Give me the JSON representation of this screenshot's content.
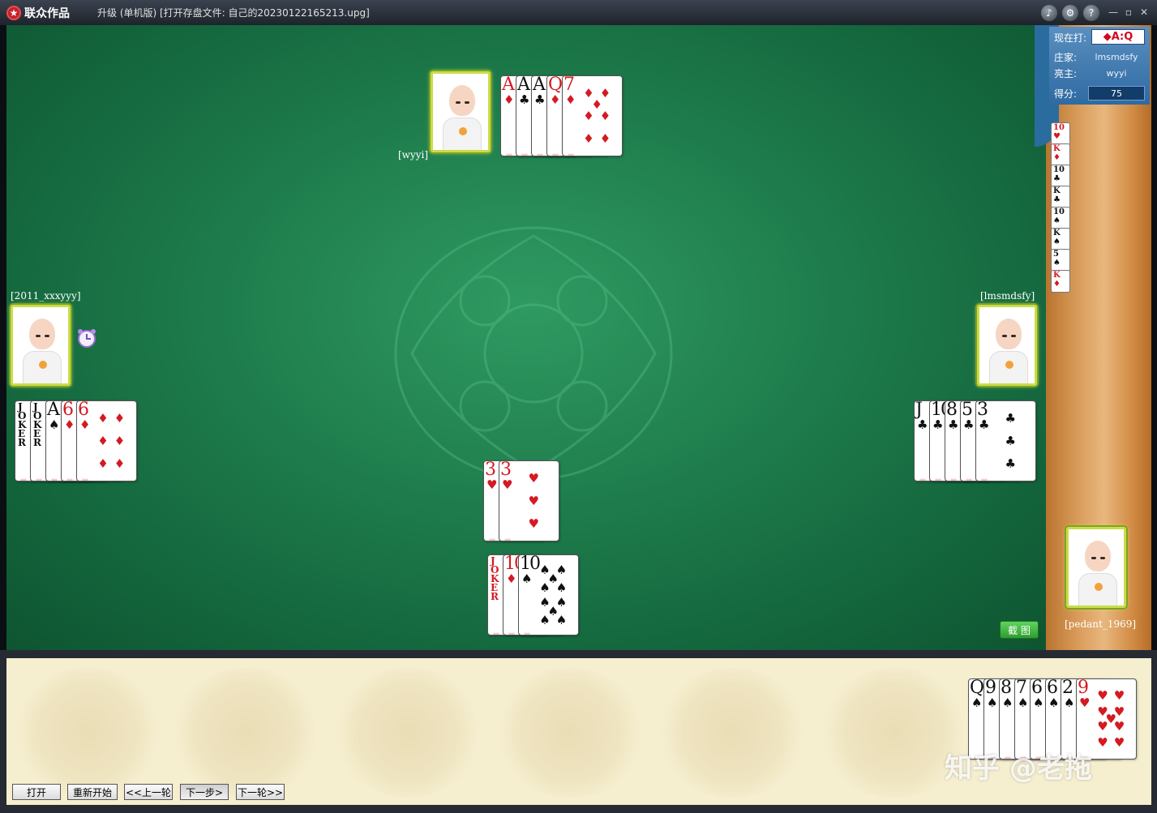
{
  "titlebar": {
    "logo_text": "联众作品",
    "window_title": "升级 (单机版) [打开存盘文件: 自己的20230122165213.upg]",
    "icons": [
      "sound-icon",
      "settings-icon",
      "help-icon"
    ],
    "window_controls": {
      "minimize": "—",
      "restore": "▫",
      "close": "✕"
    }
  },
  "info": {
    "trump_label": "现在打:",
    "trump_value": "◆A:Q",
    "dealer_label": "庄家:",
    "dealer_value": "lmsmdsfy",
    "declarer_label": "亮主:",
    "declarer_value": "wyyi",
    "score_label": "得分:",
    "score_value": "75"
  },
  "kitty_cards": [
    {
      "rank": "10",
      "suit": "♥",
      "color": "red"
    },
    {
      "rank": "K",
      "suit": "♦",
      "color": "red"
    },
    {
      "rank": "10",
      "suit": "♣",
      "color": "black"
    },
    {
      "rank": "K",
      "suit": "♣",
      "color": "black"
    },
    {
      "rank": "10",
      "suit": "♠",
      "color": "black"
    },
    {
      "rank": "K",
      "suit": "♠",
      "color": "black"
    },
    {
      "rank": "5",
      "suit": "♠",
      "color": "black"
    },
    {
      "rank": "K",
      "suit": "♦",
      "color": "red"
    }
  ],
  "players": {
    "north": {
      "name": "[wyyi]"
    },
    "west": {
      "name": "[2011_xxxyyy]"
    },
    "east": {
      "name": "[lmsmdsfy]"
    },
    "south": {
      "name": "[pedant_1969]"
    }
  },
  "tricks": {
    "north": [
      {
        "rank": "A",
        "suit": "♦",
        "color": "red"
      },
      {
        "rank": "A",
        "suit": "♣",
        "color": "black"
      },
      {
        "rank": "A",
        "suit": "♣",
        "color": "black"
      },
      {
        "rank": "Q",
        "suit": "♦",
        "color": "red"
      },
      {
        "rank": "7",
        "suit": "♦",
        "color": "red"
      }
    ],
    "west": [
      {
        "rank": "JOKER",
        "suit": "",
        "color": "black"
      },
      {
        "rank": "JOKER",
        "suit": "",
        "color": "black"
      },
      {
        "rank": "A",
        "suit": "♠",
        "color": "black"
      },
      {
        "rank": "6",
        "suit": "♦",
        "color": "red"
      },
      {
        "rank": "6",
        "suit": "♦",
        "color": "red"
      }
    ],
    "east": [
      {
        "rank": "J",
        "suit": "♣",
        "color": "black"
      },
      {
        "rank": "10",
        "suit": "♣",
        "color": "black"
      },
      {
        "rank": "8",
        "suit": "♣",
        "color": "black"
      },
      {
        "rank": "5",
        "suit": "♣",
        "color": "black"
      },
      {
        "rank": "3",
        "suit": "♣",
        "color": "black"
      }
    ],
    "center": [
      {
        "rank": "3",
        "suit": "♥",
        "color": "red"
      },
      {
        "rank": "3",
        "suit": "♥",
        "color": "red"
      }
    ],
    "south": [
      {
        "rank": "JOKER",
        "suit": "",
        "color": "red"
      },
      {
        "rank": "10",
        "suit": "♦",
        "color": "red"
      },
      {
        "rank": "10",
        "suit": "♠",
        "color": "black"
      }
    ]
  },
  "hand": [
    {
      "rank": "Q",
      "suit": "♠",
      "color": "black"
    },
    {
      "rank": "9",
      "suit": "♠",
      "color": "black"
    },
    {
      "rank": "8",
      "suit": "♠",
      "color": "black"
    },
    {
      "rank": "7",
      "suit": "♠",
      "color": "black"
    },
    {
      "rank": "6",
      "suit": "♠",
      "color": "black"
    },
    {
      "rank": "6",
      "suit": "♠",
      "color": "black"
    },
    {
      "rank": "2",
      "suit": "♠",
      "color": "black"
    },
    {
      "rank": "9",
      "suit": "♥",
      "color": "red"
    }
  ],
  "buttons": {
    "open": "打开",
    "restart": "重新开始",
    "prev_round": "<<上一轮",
    "next_step": "下一步>",
    "next_round": "下一轮>>",
    "screenshot": "截 图"
  },
  "watermark": "知乎 @老拖"
}
